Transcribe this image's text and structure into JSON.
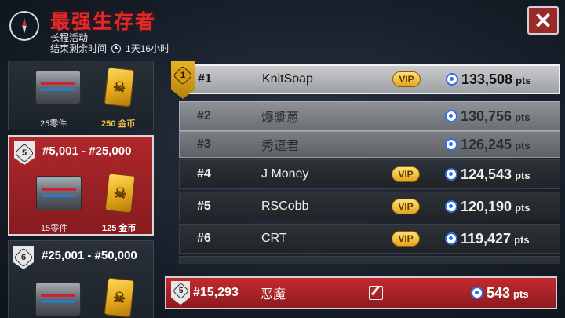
{
  "header": {
    "title": "最强生存者",
    "subtitle": "长程活动",
    "timer_label": "结束剩余时间",
    "timer_value": "1天16小时",
    "close_symbol": "✕",
    "icon": "compass-icon"
  },
  "rewards": {
    "tiers": [
      {
        "range": "",
        "badge": "",
        "parts": "25零件",
        "gold": "250 金币",
        "active": false
      },
      {
        "range": "#5,001 - #25,000",
        "badge": "5",
        "parts": "15零件",
        "gold": "125 金币",
        "active": true
      },
      {
        "range": "#25,001 - #50,000",
        "badge": "6",
        "parts": "",
        "gold": "",
        "active": false
      }
    ]
  },
  "leaderboard": {
    "rows": [
      {
        "rank": "#1",
        "name": "KnitSoap",
        "vip": true,
        "points": "133,508",
        "style": "top",
        "medal": "1"
      },
      {
        "rank": "#2",
        "name": "爆漿蒽",
        "vip": false,
        "points": "130,756",
        "style": "silver"
      },
      {
        "rank": "#3",
        "name": "秀逗君",
        "vip": false,
        "points": "126,245",
        "style": "bronze"
      },
      {
        "rank": "#4",
        "name": "J Money",
        "vip": true,
        "points": "124,543",
        "style": "normal"
      },
      {
        "rank": "#5",
        "name": "RSCobb",
        "vip": true,
        "points": "120,190",
        "style": "normal"
      },
      {
        "rank": "#6",
        "name": "CRT",
        "vip": true,
        "points": "119,427",
        "style": "normal"
      }
    ],
    "vip_label": "VIP",
    "pts_unit": "pts"
  },
  "my_rank": {
    "badge": "5",
    "rank": "#15,293",
    "name": "恶魔",
    "points": "543",
    "pts_unit": "pts"
  },
  "colors": {
    "title_red": "#e02a2a",
    "active_red": "#b0272b",
    "gold": "#e3a51c",
    "points_blue": "#2d6fe8"
  }
}
